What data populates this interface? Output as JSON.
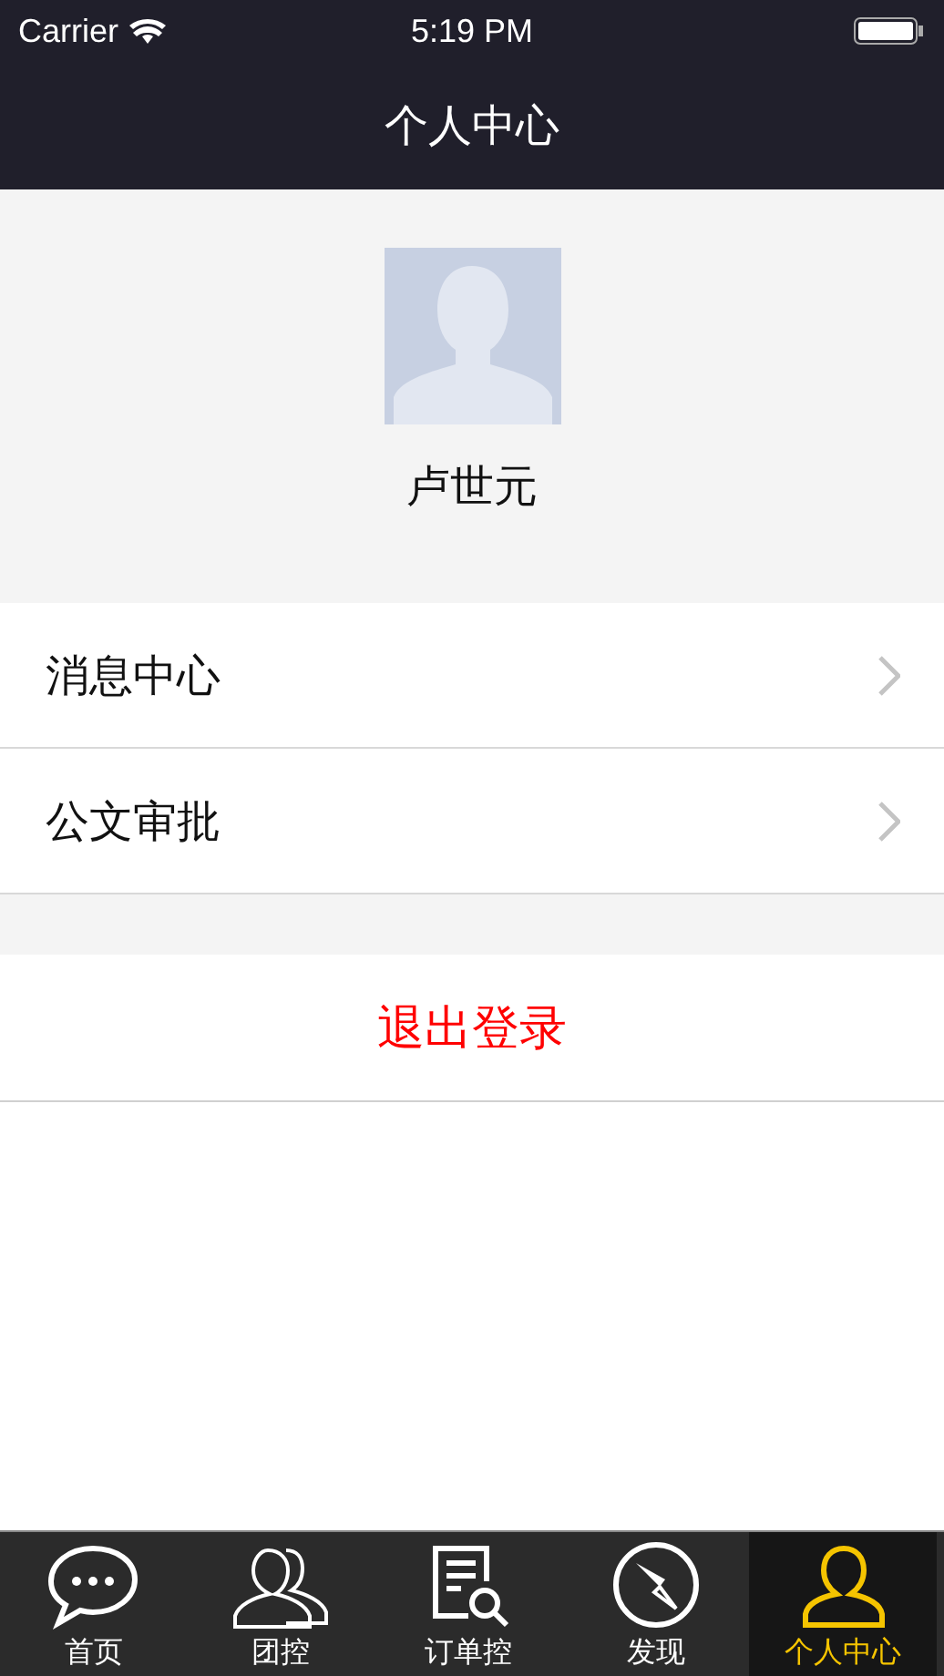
{
  "status_bar": {
    "carrier": "Carrier",
    "time": "5:19 PM"
  },
  "nav": {
    "title": "个人中心"
  },
  "profile": {
    "name": "卢世元"
  },
  "menu": [
    {
      "label": "消息中心"
    },
    {
      "label": "公文审批"
    }
  ],
  "logout": {
    "label": "退出登录"
  },
  "tabs": [
    {
      "label": "首页",
      "kind": "chat",
      "selected": false
    },
    {
      "label": "团控",
      "kind": "people",
      "selected": false
    },
    {
      "label": "订单控",
      "kind": "doc",
      "selected": false
    },
    {
      "label": "发现",
      "kind": "compass",
      "selected": false
    },
    {
      "label": "个人中心",
      "kind": "person",
      "selected": true
    }
  ]
}
